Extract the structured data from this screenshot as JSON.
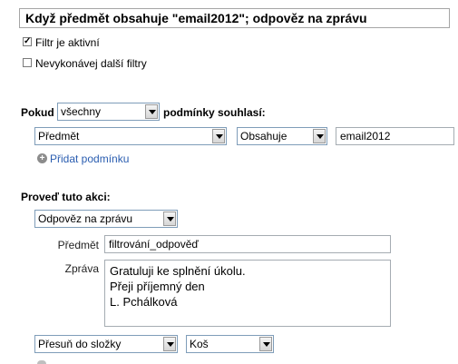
{
  "filter": {
    "title": "Když předmět obsahuje \"email2012\"; odpověz na zprávu",
    "active_label": "Filtr je aktivní",
    "active_checked": true,
    "stop_label": "Nevykonávej další filtry",
    "stop_checked": false
  },
  "conditions": {
    "prefix": "Pokud",
    "match_value": "všechny",
    "suffix": "podmínky souhlasí:",
    "field_value": "Předmět",
    "operator_value": "Obsahuje",
    "query_value": "email2012",
    "add_condition_label": "Přidat podmínku"
  },
  "action": {
    "heading": "Proveď tuto akci:",
    "action_value": "Odpověz na zprávu",
    "subject_label": "Předmět",
    "subject_value": "filtrování_odpověď",
    "message_label": "Zpráva",
    "message_lines": [
      "Gratuluji ke splnění úkolu.",
      "Přeji příjemný den",
      "L. Pchálková"
    ],
    "move_value": "Přesuň do složky",
    "folder_value": "Koš"
  }
}
